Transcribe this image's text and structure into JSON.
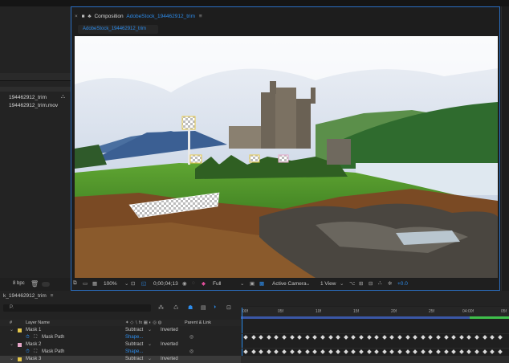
{
  "project": {
    "items": [
      "194462912_trim",
      "194462912_trim.mov"
    ],
    "bpc": "8 bpc"
  },
  "composition": {
    "panel_title_prefix": "Composition",
    "panel_title_name": "AdobeStock_194462912_trim",
    "tab_label": "AdobeStock_194462912_trim"
  },
  "viewer_toolbar": {
    "zoom": "100%",
    "timecode": "0;00;04;13",
    "resolution": "Full",
    "camera": "Active Camera",
    "view": "1 View",
    "exposure": "+0.0"
  },
  "timeline": {
    "comp_tab": "k_194462912_trim",
    "search_placeholder": "Ρ.",
    "headers": {
      "num": "#",
      "layer_name": "Layer Name",
      "parent": "Parent & Link"
    },
    "ruler_ticks": [
      "00f",
      "05f",
      "10f",
      "15f",
      "20f",
      "25f",
      "04:00f",
      "05f"
    ],
    "layers": [
      {
        "kind": "mask",
        "name": "Mask 1",
        "mode": "Subtract",
        "inverted": "Inverted",
        "color": "#e6c84b"
      },
      {
        "kind": "prop",
        "name": "Mask Path",
        "value": "Shape..."
      },
      {
        "kind": "mask",
        "name": "Mask 2",
        "mode": "Subtract",
        "inverted": "Inverted",
        "color": "#e6a5c8"
      },
      {
        "kind": "prop",
        "name": "Mask Path",
        "value": "Shape..."
      },
      {
        "kind": "mask",
        "name": "Mask 3",
        "mode": "Subtract",
        "inverted": "Inverted",
        "color": "#e6c84b"
      }
    ]
  },
  "colors": {
    "accent": "#2d8ceb",
    "work_area": "#3fbf4b"
  }
}
